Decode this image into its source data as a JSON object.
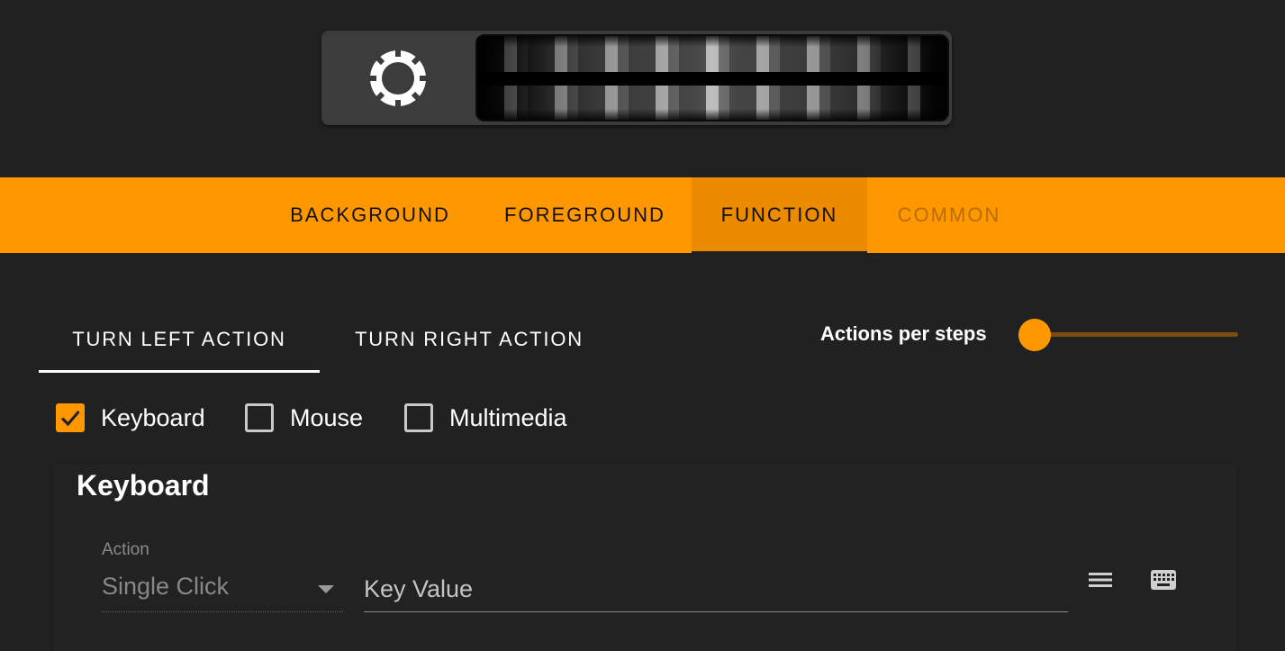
{
  "main_tabs": [
    {
      "label": "BACKGROUND"
    },
    {
      "label": "FOREGROUND"
    },
    {
      "label": "FUNCTION"
    },
    {
      "label": "COMMON"
    }
  ],
  "active_main_tab": "FUNCTION",
  "sub_tabs": [
    {
      "label": "TURN LEFT ACTION"
    },
    {
      "label": "TURN RIGHT ACTION"
    }
  ],
  "active_sub_tab": "TURN LEFT ACTION",
  "actions_per_steps": {
    "label": "Actions per steps",
    "slider_fraction": 0.0
  },
  "action_types": [
    {
      "label": "Keyboard",
      "checked": true
    },
    {
      "label": "Mouse",
      "checked": false
    },
    {
      "label": "Multimedia",
      "checked": false
    }
  ],
  "keyboard": {
    "title": "Keyboard",
    "action_label": "Action",
    "action_value": "Single Click",
    "key_placeholder": "Key Value"
  },
  "icons": {
    "preview": "gear-ring-icon",
    "menu": "menu-icon",
    "keyboard": "keyboard-icon"
  },
  "colors": {
    "accent": "#ff9800",
    "active_tab_bg": "#ec8a00",
    "disabled_tab": "#b76e00",
    "background": "#212121"
  }
}
